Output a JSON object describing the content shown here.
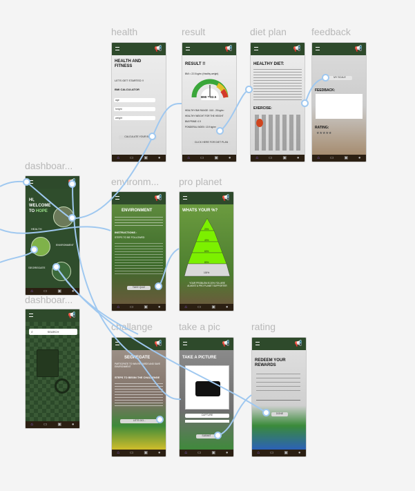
{
  "frames": {
    "health": "health",
    "result": "result",
    "diet_plan": "diet plan",
    "feedback": "feedback",
    "dashboard1": "dashboar...",
    "environment": "environm...",
    "pro_planet": "pro planet",
    "dashboard2": "dashboar...",
    "challange": "challange",
    "take_a_pic": "take a pic",
    "rating": "rating"
  },
  "health": {
    "title": "HEALTH AND FITNESS",
    "subtitle": "LETS GET STARTED !!",
    "section": "BMI CALCULATOR",
    "fields": [
      "age",
      "height",
      "weight"
    ],
    "button": "CALCULATE YOUR BMI"
  },
  "result": {
    "title": "RESULT !!",
    "line": "BMI = 22.5 kg/m² (Healthy weight)",
    "gauge_value": "BMI = 22.5",
    "bullets": [
      "HEALTHY BMI RANGE: 18.5 - 25 kg/m²",
      "HEALTHY WEIGHT FOR THE HEIGHT",
      "BMI PRIME: 0.9",
      "PONDERAL INDEX: 13.9 kg/m³"
    ],
    "button": "CLICK HERE FOR DIET PLAN"
  },
  "diet": {
    "title": "HEALTHY DIET:",
    "exercise": "EXERCISE:"
  },
  "feedback": {
    "button": "MY SCALE",
    "feedback_label": "FEEDBACK:",
    "rating_label": "RATING:",
    "stars": "★★★★★"
  },
  "dashboard1": {
    "greeting": "HI, WELCOME TO",
    "brand": "HOPE",
    "items": [
      "HEALTH",
      "ENVIRONMENT",
      "SEGREGATE"
    ]
  },
  "environment": {
    "title": "ENVIRONMENT",
    "instructions": "INSTRUCTIONS :",
    "steps": "STEPS TO BE FOLLOWED",
    "button": "TAKE QUIZ"
  },
  "pro_planet": {
    "title": "WHATS YOUR %?",
    "levels": [
      "20%",
      "40%",
      "60%",
      "80%",
      "100%"
    ],
    "footer": "YOUR PROBLEM IS 20% YOU ARE ALMOST A PRO PLANET SUPPORTER"
  },
  "dashboard2": {
    "search": "SEARCH"
  },
  "challange": {
    "title": "SEGREGATE",
    "subtitle": "PARTICIPATE TO WIN REWARDS AND SAVE ENVIRONMENT",
    "steps_title": "STEPS TO BEGIN THE CHALLENGE",
    "button": "LETS GO..."
  },
  "take_pic": {
    "title": "TAKE A PICTURE",
    "capture": "CAPTURE",
    "submit": "SUBMIT"
  },
  "rating": {
    "title": "REDEEM YOUR REWARDS",
    "button": "DONE"
  },
  "icons": {
    "nav": [
      "home-icon",
      "cart-icon",
      "gallery-icon",
      "profile-icon"
    ],
    "top": "megaphone-icon"
  }
}
